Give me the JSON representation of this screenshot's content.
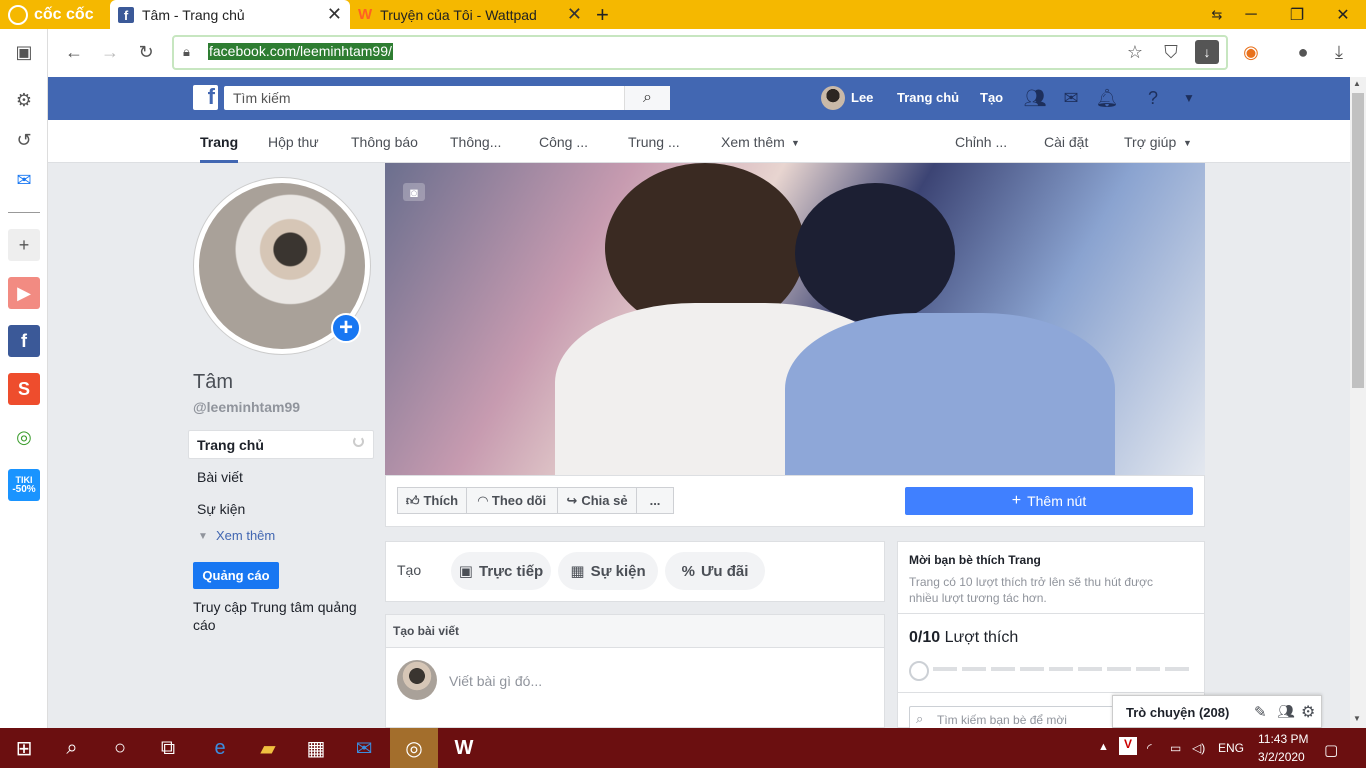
{
  "browser": {
    "tabs": [
      {
        "label": "cốc cốc"
      },
      {
        "label": "Tâm - Trang chủ"
      },
      {
        "label": "Truyện của Tôi - Wattpad"
      }
    ],
    "new_tab": "+",
    "url": "facebook.com/leeminhtam99/"
  },
  "sidebar": {
    "tiki_label": "TIKI",
    "tiki_badge": "-50%"
  },
  "fb_header": {
    "search_placeholder": "Tìm kiếm",
    "user_name": "Lee",
    "home": "Trang chủ",
    "create": "Tạo"
  },
  "page_nav": {
    "items": [
      "Trang",
      "Hộp thư",
      "Thông báo",
      "Thông...",
      "Công ...",
      "Trung ...",
      "Xem thêm",
      "Chỉnh ...",
      "Cài đặt",
      "Trợ giúp"
    ]
  },
  "profile": {
    "name": "Tâm",
    "handle": "@leeminhtam99",
    "menu": [
      "Trang chủ",
      "Bài viết",
      "Sự kiện",
      "Xem thêm"
    ],
    "ads_button": "Quảng cáo",
    "ads_link": "Truy cập Trung tâm quảng cáo"
  },
  "actions": {
    "like": "Thích",
    "follow": "Theo dõi",
    "share": "Chia sẻ",
    "more": "...",
    "add_button": "Thêm nút"
  },
  "create": {
    "label": "Tạo",
    "live": "Trực tiếp",
    "event": "Sự kiện",
    "offer": "Ưu đãi",
    "post_title": "Tạo bài viết",
    "post_placeholder": "Viết bài gì đó..."
  },
  "invite": {
    "title": "Mời bạn bè thích Trang",
    "desc": "Trang có 10 lượt thích trở lên sẽ thu hút được nhiều lượt tương tác hơn.",
    "likes_count": "0/10",
    "likes_label": "Lượt thích",
    "search_placeholder": "Tìm kiếm bạn bè để mời"
  },
  "chat": {
    "label": "Trò chuyện (208)"
  },
  "taskbar": {
    "lang": "ENG",
    "time": "11:43 PM",
    "date": "3/2/2020"
  }
}
